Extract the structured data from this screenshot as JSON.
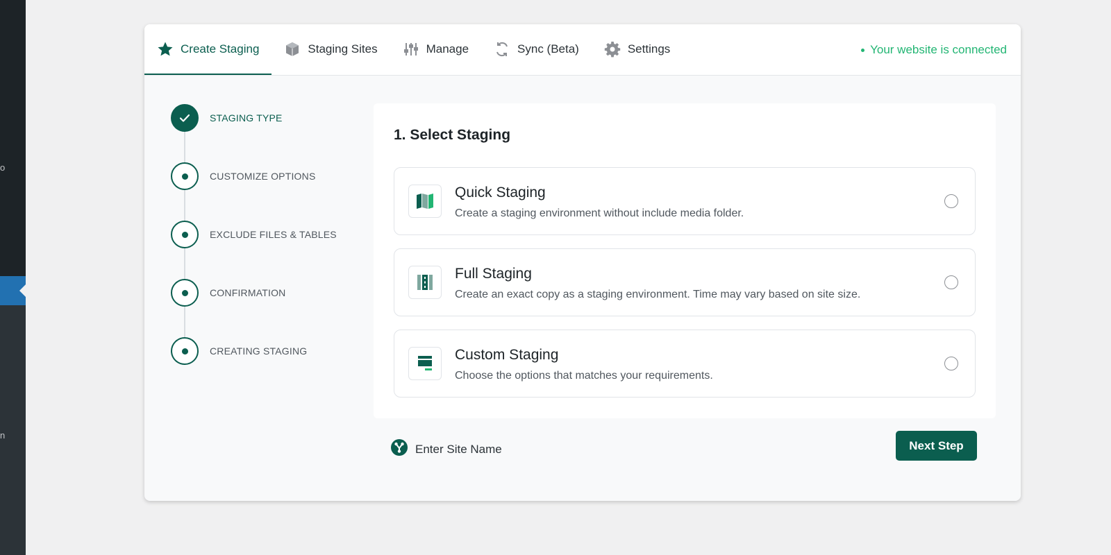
{
  "wp_sidebar": {
    "fragments": [
      "o",
      "n"
    ]
  },
  "tabs": [
    {
      "label": "Create Staging",
      "icon": "star-icon",
      "active": true
    },
    {
      "label": "Staging Sites",
      "icon": "cube-icon",
      "active": false
    },
    {
      "label": "Manage",
      "icon": "sliders-icon",
      "active": false
    },
    {
      "label": "Sync (Beta)",
      "icon": "sync-icon",
      "active": false
    },
    {
      "label": "Settings",
      "icon": "gear-icon",
      "active": false
    }
  ],
  "status": {
    "text": "Your website is connected",
    "color": "#22b573"
  },
  "steps": [
    {
      "label": "STAGING TYPE",
      "state": "done"
    },
    {
      "label": "CUSTOMIZE OPTIONS",
      "state": "pending"
    },
    {
      "label": "EXCLUDE FILES & TABLES",
      "state": "pending"
    },
    {
      "label": "CONFIRMATION",
      "state": "pending"
    },
    {
      "label": "CREATING STAGING",
      "state": "pending"
    }
  ],
  "panel": {
    "title": "1. Select Staging",
    "options": [
      {
        "title": "Quick Staging",
        "description": "Create a staging environment without include media folder.",
        "icon": "map-icon",
        "selected": false
      },
      {
        "title": "Full Staging",
        "description": "Create an exact copy as a staging environment. Time may vary based on site size.",
        "icon": "film-icon",
        "selected": false
      },
      {
        "title": "Custom Staging",
        "description": "Choose the options that matches your requirements.",
        "icon": "monitor-icon",
        "selected": false
      }
    ]
  },
  "footer": {
    "site_name_label": "Enter Site Name",
    "next_label": "Next Step"
  },
  "colors": {
    "accent": "#0b5e4f",
    "accent_light": "#22b573"
  }
}
